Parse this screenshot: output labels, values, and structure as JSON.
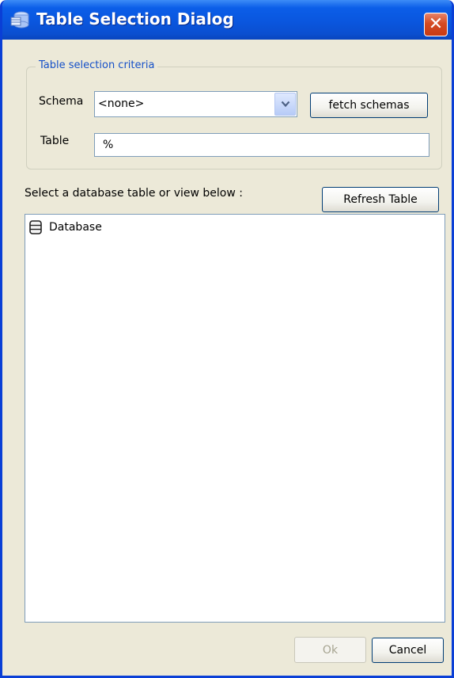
{
  "window": {
    "title": "Table Selection Dialog"
  },
  "criteria": {
    "legend": "Table selection criteria",
    "schema_label": "Schema",
    "schema_value": "<none>",
    "fetch_label": "fetch schemas",
    "table_label": "Table",
    "table_value": "%"
  },
  "list": {
    "prompt": "Select a database table or view below :",
    "refresh_label": "Refresh Table",
    "tree": [
      {
        "label": "Database",
        "icon": "database-icon"
      }
    ]
  },
  "footer": {
    "ok_label": "Ok",
    "ok_enabled": false,
    "cancel_label": "Cancel"
  },
  "colors": {
    "titlebar": "#0a56de",
    "frame": "#0a3fd6",
    "face": "#ece9d8",
    "close": "#d44a22",
    "legend": "#1550c8"
  }
}
